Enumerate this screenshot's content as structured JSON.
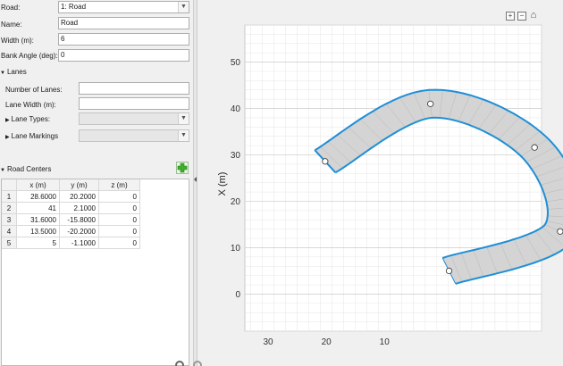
{
  "road": {
    "label": "Road:",
    "selected": "1: Road"
  },
  "name": {
    "label": "Name:",
    "value": "Road"
  },
  "width": {
    "label": "Width (m):",
    "value": "6"
  },
  "bank_angle": {
    "label": "Bank Angle (deg):",
    "value": "0"
  },
  "lanes": {
    "header": "Lanes",
    "num_lanes_label": "Number of Lanes:",
    "num_lanes_value": "",
    "lane_width_label": "Lane Width (m):",
    "lane_types_label": "Lane Types:",
    "lane_markings_label": "Lane Markings"
  },
  "road_centers": {
    "header": "Road Centers",
    "columns": [
      "x (m)",
      "y (m)",
      "z (m)"
    ],
    "rows": [
      {
        "index": "1",
        "x": "28.6000",
        "y": "20.2000",
        "z": "0"
      },
      {
        "index": "2",
        "x": "41",
        "y": "2.1000",
        "z": "0"
      },
      {
        "index": "3",
        "x": "31.6000",
        "y": "-15.8000",
        "z": "0"
      },
      {
        "index": "4",
        "x": "13.5000",
        "y": "-20.2000",
        "z": "0"
      },
      {
        "index": "5",
        "x": "5",
        "y": "-1.1000",
        "z": "0"
      }
    ]
  },
  "toolbar": {
    "zoom_in": "+",
    "zoom_out": "−",
    "home": "⌂"
  },
  "colors": {
    "road_edge": "#1f8fd6",
    "road_fill": "#d4d4d4",
    "grid": "#e6e6e6",
    "panel": "#f0f0f0"
  },
  "chart_data": {
    "type": "line",
    "xlabel": "",
    "ylabel": "X (m)",
    "x_axis_reversed": true,
    "xlim": [
      34,
      -17
    ],
    "ylim": [
      -8,
      58
    ],
    "xticks": [
      30,
      20,
      10
    ],
    "yticks": [
      0,
      10,
      20,
      30,
      40,
      50
    ],
    "grid": true,
    "road_width": 6,
    "series": [
      {
        "points": [
          {
            "x": 28.6,
            "y": 20.2
          },
          {
            "x": 41,
            "y": 2.1
          },
          {
            "x": 31.6,
            "y": -15.8
          },
          {
            "x": 13.5,
            "y": -20.2
          },
          {
            "x": 5,
            "y": -1.1
          }
        ]
      }
    ]
  }
}
